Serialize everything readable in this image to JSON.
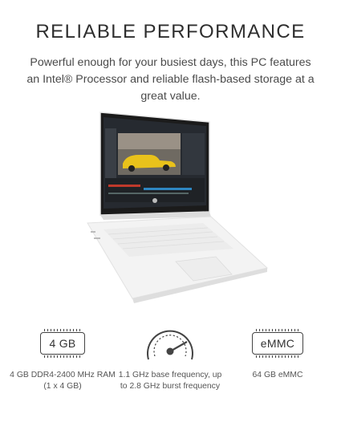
{
  "heading": "RELIABLE PERFORMANCE",
  "description": "Powerful enough for your busiest days, this PC features an Intel® Processor and reliable flash-based storage at a great value.",
  "features": [
    {
      "icon": "memory-chip-icon",
      "badge": "4 GB",
      "text": "4 GB DDR4-2400 MHz RAM (1 x 4 GB)"
    },
    {
      "icon": "speedometer-icon",
      "text": "1.1 GHz base frequency, up to 2.8 GHz burst frequency"
    },
    {
      "icon": "storage-chip-icon",
      "badge": "eMMC",
      "text": "64 GB eMMC"
    }
  ],
  "colors": {
    "text_dark": "#2e2e2e",
    "text_body": "#4a4a4a",
    "laptop_body": "#f4f4f4",
    "screen_bezel": "#1a1a1a"
  }
}
